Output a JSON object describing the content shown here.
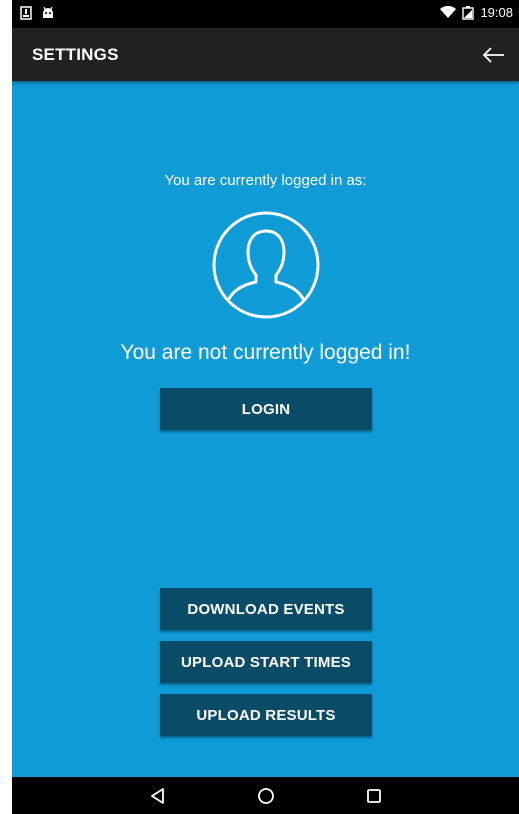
{
  "status_bar": {
    "time": "19:08",
    "icons": [
      "notification-download-icon",
      "android-icon",
      "wifi-icon",
      "battery-icon"
    ]
  },
  "app_bar": {
    "title": "SETTINGS",
    "back_icon": "arrow-left-icon"
  },
  "account": {
    "label": "You are currently logged in as:",
    "avatar_icon": "user-avatar-icon",
    "status": "You are not currently logged in!",
    "login_button": "LOGIN"
  },
  "actions": {
    "download_events": "DOWNLOAD EVENTS",
    "upload_start_times": "UPLOAD START TIMES",
    "upload_results": "UPLOAD RESULTS"
  },
  "nav_bar": {
    "icons": [
      "nav-back-icon",
      "nav-home-icon",
      "nav-recents-icon"
    ]
  },
  "colors": {
    "background": "#0e9bd6",
    "app_bar": "#212121",
    "button": "#0a4b68",
    "text": "#ffffff"
  }
}
